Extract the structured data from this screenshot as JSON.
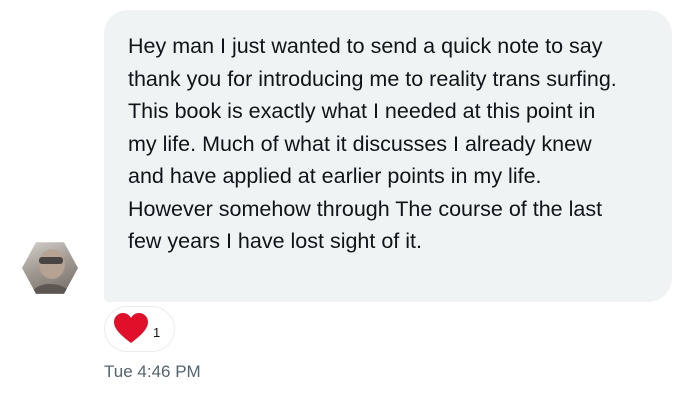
{
  "message": {
    "text": "Hey man I just wanted to send a quick note to say thank you for introducing me to reality trans surfing. This book is exactly what I needed at this point in my life. Much of what it discusses I already knew and have applied at earlier points in my life. However somehow through The course of the last few years I have lost sight of it.",
    "timestamp": "Tue 4:46 PM"
  },
  "reaction": {
    "icon": "heart-icon",
    "count": "1",
    "color": "#e0102a"
  },
  "sender": {
    "avatar_icon": "avatar"
  },
  "colors": {
    "bubble_bg": "#eff3f4",
    "text": "#0f1419",
    "muted": "#536471"
  }
}
